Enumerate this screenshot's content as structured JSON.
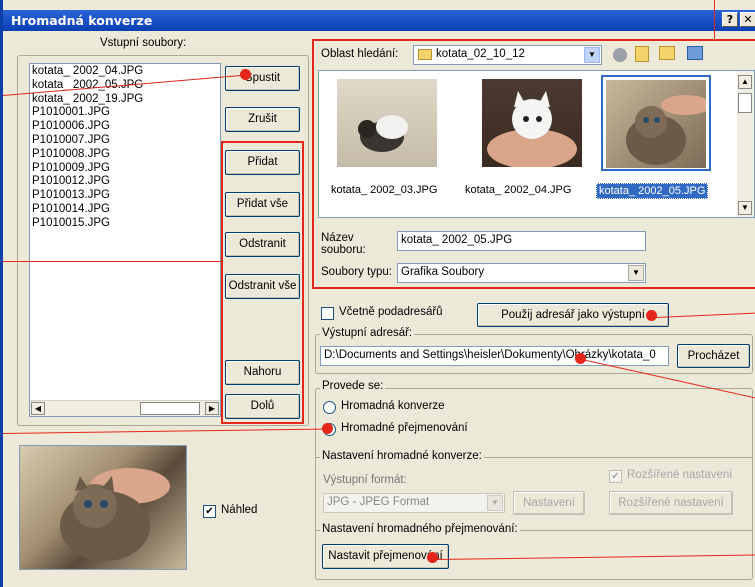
{
  "window": {
    "title": "Hromadná konverze",
    "help": "?",
    "close": "✕"
  },
  "input_files": {
    "label": "Vstupní soubory:",
    "items": [
      "kotata_ 2002_04.JPG",
      "kotata_ 2002_05.JPG",
      "kotata_ 2002_19.JPG",
      "P1010001.JPG",
      "P1010006.JPG",
      "P1010007.JPG",
      "P1010008.JPG",
      "P1010009.JPG",
      "P1010012.JPG",
      "P1010013.JPG",
      "P1010014.JPG",
      "P1010015.JPG"
    ]
  },
  "buttons": {
    "start": "Spustit",
    "cancel": "Zrušit",
    "add": "Přidat",
    "add_all": "Přidat vše",
    "remove": "Odstranit",
    "remove_all": "Odstranit vše",
    "up": "Nahoru",
    "down": "Dolů"
  },
  "browser": {
    "look_in_label": "Oblast hledání:",
    "folder": "kotata_02_10_12",
    "thumbs": [
      "kotata_ 2002_03.JPG",
      "kotata_ 2002_04.JPG",
      "kotata_ 2002_05.JPG"
    ],
    "filename_label": "Název\nsouboru:",
    "filename_value": "kotata_ 2002_05.JPG",
    "filetype_label": "Soubory typu:",
    "filetype_value": "Grafika Soubory"
  },
  "options": {
    "include_subdirs": "Včetně podadresářů",
    "use_as_output": "Použij adresář jako výstupní",
    "output_dir_label": "Výstupní adresář:",
    "output_dir_value": "D:\\Documents and Settings\\heisler\\Dokumenty\\Obrázky\\kotata_0",
    "browse": "Procházet"
  },
  "perform": {
    "label": "Provede se:",
    "batch_convert": "Hromadná konverze",
    "batch_rename": "Hromadné přejmenování"
  },
  "convert_settings": {
    "label": "Nastavení hromadné konverze:",
    "format_label": "Výstupní formát:",
    "format_value": "JPG - JPEG Format",
    "settings_btn": "Nastavení",
    "advanced_chk": "Rozšířené nastavení",
    "advanced_btn": "Rozšířené nastavení"
  },
  "rename_settings": {
    "label": "Nastavení hromadného přejmenování:",
    "button": "Nastavit přejmenování"
  },
  "preview": {
    "label": "Náhled"
  },
  "colors": {
    "accent": "#e4261c",
    "title": "#0b3fb4"
  }
}
